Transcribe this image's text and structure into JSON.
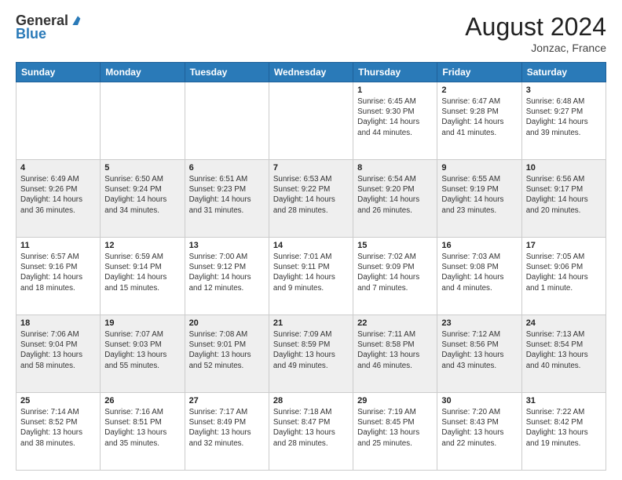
{
  "header": {
    "logo_general": "General",
    "logo_blue": "Blue",
    "month_title": "August 2024",
    "location": "Jonzac, France"
  },
  "calendar": {
    "days_of_week": [
      "Sunday",
      "Monday",
      "Tuesday",
      "Wednesday",
      "Thursday",
      "Friday",
      "Saturday"
    ],
    "weeks": [
      [
        {
          "day": "",
          "info": ""
        },
        {
          "day": "",
          "info": ""
        },
        {
          "day": "",
          "info": ""
        },
        {
          "day": "",
          "info": ""
        },
        {
          "day": "1",
          "info": "Sunrise: 6:45 AM\nSunset: 9:30 PM\nDaylight: 14 hours and 44 minutes."
        },
        {
          "day": "2",
          "info": "Sunrise: 6:47 AM\nSunset: 9:28 PM\nDaylight: 14 hours and 41 minutes."
        },
        {
          "day": "3",
          "info": "Sunrise: 6:48 AM\nSunset: 9:27 PM\nDaylight: 14 hours and 39 minutes."
        }
      ],
      [
        {
          "day": "4",
          "info": "Sunrise: 6:49 AM\nSunset: 9:26 PM\nDaylight: 14 hours and 36 minutes."
        },
        {
          "day": "5",
          "info": "Sunrise: 6:50 AM\nSunset: 9:24 PM\nDaylight: 14 hours and 34 minutes."
        },
        {
          "day": "6",
          "info": "Sunrise: 6:51 AM\nSunset: 9:23 PM\nDaylight: 14 hours and 31 minutes."
        },
        {
          "day": "7",
          "info": "Sunrise: 6:53 AM\nSunset: 9:22 PM\nDaylight: 14 hours and 28 minutes."
        },
        {
          "day": "8",
          "info": "Sunrise: 6:54 AM\nSunset: 9:20 PM\nDaylight: 14 hours and 26 minutes."
        },
        {
          "day": "9",
          "info": "Sunrise: 6:55 AM\nSunset: 9:19 PM\nDaylight: 14 hours and 23 minutes."
        },
        {
          "day": "10",
          "info": "Sunrise: 6:56 AM\nSunset: 9:17 PM\nDaylight: 14 hours and 20 minutes."
        }
      ],
      [
        {
          "day": "11",
          "info": "Sunrise: 6:57 AM\nSunset: 9:16 PM\nDaylight: 14 hours and 18 minutes."
        },
        {
          "day": "12",
          "info": "Sunrise: 6:59 AM\nSunset: 9:14 PM\nDaylight: 14 hours and 15 minutes."
        },
        {
          "day": "13",
          "info": "Sunrise: 7:00 AM\nSunset: 9:12 PM\nDaylight: 14 hours and 12 minutes."
        },
        {
          "day": "14",
          "info": "Sunrise: 7:01 AM\nSunset: 9:11 PM\nDaylight: 14 hours and 9 minutes."
        },
        {
          "day": "15",
          "info": "Sunrise: 7:02 AM\nSunset: 9:09 PM\nDaylight: 14 hours and 7 minutes."
        },
        {
          "day": "16",
          "info": "Sunrise: 7:03 AM\nSunset: 9:08 PM\nDaylight: 14 hours and 4 minutes."
        },
        {
          "day": "17",
          "info": "Sunrise: 7:05 AM\nSunset: 9:06 PM\nDaylight: 14 hours and 1 minute."
        }
      ],
      [
        {
          "day": "18",
          "info": "Sunrise: 7:06 AM\nSunset: 9:04 PM\nDaylight: 13 hours and 58 minutes."
        },
        {
          "day": "19",
          "info": "Sunrise: 7:07 AM\nSunset: 9:03 PM\nDaylight: 13 hours and 55 minutes."
        },
        {
          "day": "20",
          "info": "Sunrise: 7:08 AM\nSunset: 9:01 PM\nDaylight: 13 hours and 52 minutes."
        },
        {
          "day": "21",
          "info": "Sunrise: 7:09 AM\nSunset: 8:59 PM\nDaylight: 13 hours and 49 minutes."
        },
        {
          "day": "22",
          "info": "Sunrise: 7:11 AM\nSunset: 8:58 PM\nDaylight: 13 hours and 46 minutes."
        },
        {
          "day": "23",
          "info": "Sunrise: 7:12 AM\nSunset: 8:56 PM\nDaylight: 13 hours and 43 minutes."
        },
        {
          "day": "24",
          "info": "Sunrise: 7:13 AM\nSunset: 8:54 PM\nDaylight: 13 hours and 40 minutes."
        }
      ],
      [
        {
          "day": "25",
          "info": "Sunrise: 7:14 AM\nSunset: 8:52 PM\nDaylight: 13 hours and 38 minutes."
        },
        {
          "day": "26",
          "info": "Sunrise: 7:16 AM\nSunset: 8:51 PM\nDaylight: 13 hours and 35 minutes."
        },
        {
          "day": "27",
          "info": "Sunrise: 7:17 AM\nSunset: 8:49 PM\nDaylight: 13 hours and 32 minutes."
        },
        {
          "day": "28",
          "info": "Sunrise: 7:18 AM\nSunset: 8:47 PM\nDaylight: 13 hours and 28 minutes."
        },
        {
          "day": "29",
          "info": "Sunrise: 7:19 AM\nSunset: 8:45 PM\nDaylight: 13 hours and 25 minutes."
        },
        {
          "day": "30",
          "info": "Sunrise: 7:20 AM\nSunset: 8:43 PM\nDaylight: 13 hours and 22 minutes."
        },
        {
          "day": "31",
          "info": "Sunrise: 7:22 AM\nSunset: 8:42 PM\nDaylight: 13 hours and 19 minutes."
        }
      ]
    ]
  }
}
